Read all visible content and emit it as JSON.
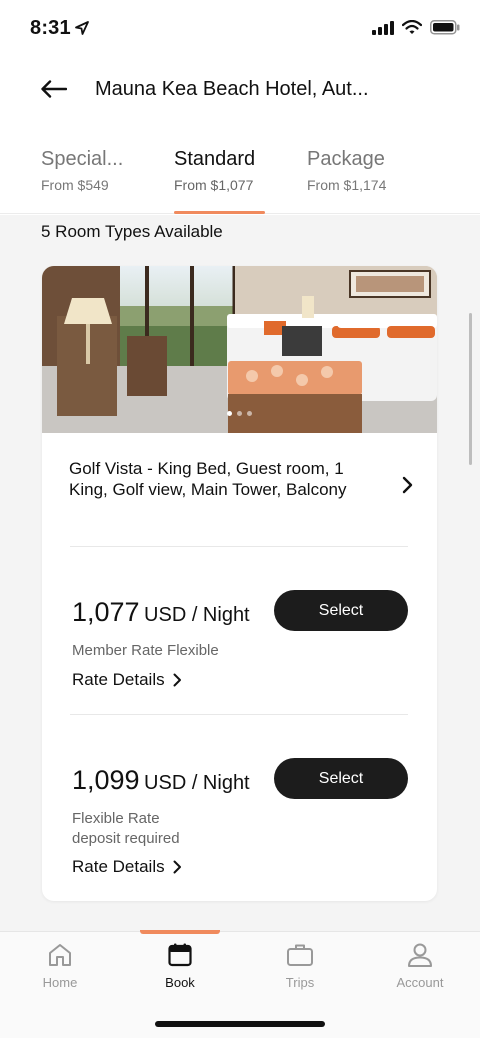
{
  "status_bar": {
    "time": "8:31"
  },
  "header": {
    "title": "Mauna Kea Beach Hotel, Aut..."
  },
  "tabs": [
    {
      "name": "Special...",
      "price": "From $549"
    },
    {
      "name": "Standard",
      "price": "From $1,077",
      "active": true
    },
    {
      "name": "Package",
      "price": "From $1,174"
    }
  ],
  "content": {
    "room_count": "5 Room Types Available",
    "card": {
      "photo_pages": 3,
      "photo_current": 1,
      "room_name": "Golf Vista - King Bed, Guest room, 1 King, Golf view, Main Tower, Balcony",
      "rates": [
        {
          "amount": "1,077",
          "unit": "USD / Night",
          "select_label": "Select",
          "name_line1": "Member Rate Flexible",
          "name_line2": "",
          "details_label": "Rate Details"
        },
        {
          "amount": "1,099",
          "unit": "USD / Night",
          "select_label": "Select",
          "name_line1": "Flexible Rate",
          "name_line2": "deposit required",
          "details_label": "Rate Details"
        }
      ]
    }
  },
  "tabbar": {
    "items": [
      {
        "label": "Home",
        "icon": "home-icon"
      },
      {
        "label": "Book",
        "icon": "calendar-icon",
        "active": true
      },
      {
        "label": "Trips",
        "icon": "briefcase-icon"
      },
      {
        "label": "Account",
        "icon": "person-icon"
      }
    ]
  },
  "colors": {
    "accent": "#f08a5d",
    "button": "#1c1c1c",
    "muted_text": "#777777"
  }
}
